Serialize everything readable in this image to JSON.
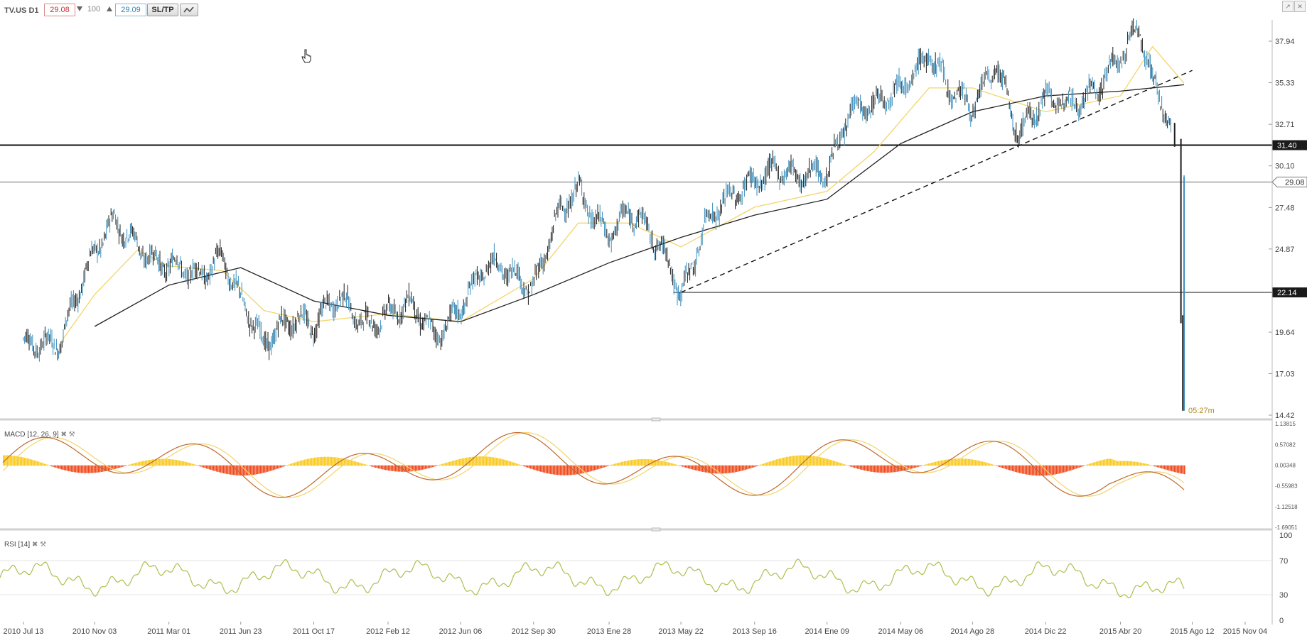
{
  "toolbar": {
    "symbol": "TV.US D1",
    "bid": "29.08",
    "ask": "29.09",
    "quantity": "100",
    "sltp_label": "SL/TP",
    "chart_type_icon": "line-chart-icon"
  },
  "window_controls": [
    "restore-icon",
    "close-icon"
  ],
  "chart_data": [
    {
      "type": "candlestick",
      "title": "TV.US D1",
      "x_ticks": [
        "2010 Jul 13",
        "2010 Nov 03",
        "2011 Mar 01",
        "2011 Jun 23",
        "2011 Oct 17",
        "2012 Feb 12",
        "2012 Jun 06",
        "2012 Sep 30",
        "2013 Ene 28",
        "2013 May 22",
        "2013 Sep 16",
        "2014 Ene 09",
        "2014 May 06",
        "2014 Ago 28",
        "2014 Dic 22",
        "2015 Abr 20",
        "2015 Ago 12",
        "2015 Nov 04"
      ],
      "y_ticks": [
        "37.94",
        "35.33",
        "32.71",
        "30.10",
        "27.48",
        "24.87",
        "19.64",
        "17.03",
        "14.42"
      ],
      "ylim": [
        14.42,
        39.5
      ],
      "current_price": "29.08",
      "countdown": "05:27m",
      "horizontal_levels": [
        {
          "value": 31.4,
          "label": "31.40",
          "style": "thick"
        },
        {
          "value": 29.08,
          "label": "29.08",
          "style": "current"
        },
        {
          "value": 22.14,
          "label": "22.14",
          "style": "thin"
        }
      ],
      "trendline": {
        "from": [
          "2013 May 22",
          22.14
        ],
        "to": [
          "2015 Ago 12",
          36.1
        ],
        "style": "dashed"
      },
      "close_series": [
        [
          "2010 Jul 13",
          18.5
        ],
        [
          "2010 Sep 10",
          19.5
        ],
        [
          "2010 Oct 05",
          22.0
        ],
        [
          "2010 Nov 03",
          24.3
        ],
        [
          "2010 Dec 05",
          26.6
        ],
        [
          "2011 Jan 10",
          25.6
        ],
        [
          "2011 Feb 05",
          24.2
        ],
        [
          "2011 Mar 01",
          23.5
        ],
        [
          "2011 Apr 15",
          23.2
        ],
        [
          "2011 May 25",
          24.8
        ],
        [
          "2011 Jun 23",
          21.5
        ],
        [
          "2011 Jul 30",
          18.5
        ],
        [
          "2011 Aug 25",
          20.2
        ],
        [
          "2011 Sep 20",
          21.0
        ],
        [
          "2011 Oct 17",
          20.0
        ],
        [
          "2011 Nov 25",
          21.5
        ],
        [
          "2012 Jan 05",
          20.5
        ],
        [
          "2012 Feb 12",
          20.9
        ],
        [
          "2012 Mar 20",
          21.0
        ],
        [
          "2012 Apr 25",
          19.5
        ],
        [
          "2012 Jun 06",
          21.5
        ],
        [
          "2012 Jul 20",
          23.5
        ],
        [
          "2012 Aug 25",
          23.5
        ],
        [
          "2012 Sep 30",
          22.8
        ],
        [
          "2012 Nov 05",
          26.5
        ],
        [
          "2012 Dec 10",
          28.4
        ],
        [
          "2013 Ene 05",
          27.0
        ],
        [
          "2013 Ene 28",
          26.2
        ],
        [
          "2013 Mar 01",
          27.2
        ],
        [
          "2013 Apr 10",
          25.2
        ],
        [
          "2013 May 05",
          24.0
        ],
        [
          "2013 May 22",
          22.3
        ],
        [
          "2013 Jul 01",
          26.5
        ],
        [
          "2013 Aug 10",
          27.8
        ],
        [
          "2013 Sep 16",
          29.5
        ],
        [
          "2013 Oct 20",
          30.2
        ],
        [
          "2013 Nov 25",
          29.0
        ],
        [
          "2014 Ene 09",
          29.8
        ],
        [
          "2014 Feb 15",
          34.0
        ],
        [
          "2014 Mar 25",
          33.5
        ],
        [
          "2014 May 06",
          35.0
        ],
        [
          "2014 Jun 20",
          37.5
        ],
        [
          "2014 Jul 25",
          34.5
        ],
        [
          "2014 Ago 28",
          33.5
        ],
        [
          "2014 Oct 05",
          37.0
        ],
        [
          "2014 Nov 10",
          32.0
        ],
        [
          "2014 Dic 22",
          34.0
        ],
        [
          "2015 Feb 01",
          34.5
        ],
        [
          "2015 Mar 15",
          35.0
        ],
        [
          "2015 Abr 20",
          36.5
        ],
        [
          "2015 May 20",
          39.0
        ],
        [
          "2015 Jun 10",
          35.8
        ],
        [
          "2015 Jul 01",
          33.8
        ],
        [
          "2015 Jul 15",
          31.5
        ],
        [
          "2015 Jul 25",
          20.4
        ],
        [
          "2015 Jul 28",
          14.9
        ],
        [
          "2015 Jul 30",
          29.08
        ]
      ],
      "moving_averages": [
        {
          "color": "#f3d56a",
          "values": [
            [
              "2010 Sep 10",
              19.0
            ],
            [
              "2010 Nov 03",
              22.0
            ],
            [
              "2011 Jan 10",
              24.8
            ],
            [
              "2011 Mar 01",
              23.8
            ],
            [
              "2011 May 25",
              23.5
            ],
            [
              "2011 Jul 30",
              21.0
            ],
            [
              "2011 Oct 17",
              20.3
            ],
            [
              "2012 Feb 12",
              20.8
            ],
            [
              "2012 Jun 06",
              20.3
            ],
            [
              "2012 Sep 30",
              23.0
            ],
            [
              "2012 Dec 10",
              26.5
            ],
            [
              "2013 Mar 01",
              26.5
            ],
            [
              "2013 May 22",
              25.0
            ],
            [
              "2013 Sep 16",
              27.5
            ],
            [
              "2014 Ene 09",
              28.5
            ],
            [
              "2014 Mar 25",
              31.0
            ],
            [
              "2014 Jun 20",
              35.0
            ],
            [
              "2014 Ago 28",
              35.0
            ],
            [
              "2014 Dic 22",
              33.5
            ],
            [
              "2015 Abr 20",
              34.5
            ],
            [
              "2015 Jun 10",
              37.6
            ],
            [
              "2015 Jul 30",
              35.3
            ]
          ]
        },
        {
          "color": "#222222",
          "values": [
            [
              "2010 Nov 03",
              20.0
            ],
            [
              "2011 Mar 01",
              22.6
            ],
            [
              "2011 Jun 23",
              23.7
            ],
            [
              "2011 Oct 17",
              21.6
            ],
            [
              "2012 Feb 12",
              20.7
            ],
            [
              "2012 Jun 06",
              20.3
            ],
            [
              "2012 Sep 30",
              22.0
            ],
            [
              "2013 Ene 28",
              24.0
            ],
            [
              "2013 May 22",
              25.6
            ],
            [
              "2013 Sep 16",
              27.0
            ],
            [
              "2014 Ene 09",
              28.0
            ],
            [
              "2014 May 06",
              31.5
            ],
            [
              "2014 Ago 28",
              33.5
            ],
            [
              "2014 Dic 22",
              34.5
            ],
            [
              "2015 Abr 20",
              34.8
            ],
            [
              "2015 Jul 30",
              35.2
            ]
          ]
        }
      ]
    },
    {
      "type": "bar",
      "title": "MACD [12, 26, 9]",
      "y_ticks": [
        "1.13815",
        "0.57082",
        "0.00348",
        "-0.55983",
        "-1.12518",
        "-1.69051"
      ],
      "ylim": [
        -1.69051,
        1.13815
      ],
      "positive_color": "#f9c91a",
      "negative_color": "#ef4a1c",
      "macd_line_color": "#c0692b",
      "signal_line_color": "#f3d56a"
    },
    {
      "type": "line",
      "title": "RSI [14]",
      "y_ticks": [
        "100",
        "70",
        "30",
        "0"
      ],
      "ylim": [
        0,
        100
      ],
      "color": "#a9c14e"
    }
  ]
}
